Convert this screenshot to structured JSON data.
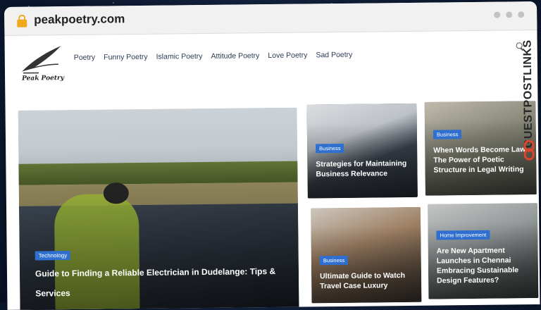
{
  "browser": {
    "url": "peakpoetry.com"
  },
  "site": {
    "logo_text": "Peak Poetry",
    "nav": [
      "Poetry",
      "Funny Poetry",
      "Islamic Poetry",
      "Attitude Poetry",
      "Love Poetry",
      "Sad Poetry"
    ]
  },
  "hero": {
    "category": "Technology",
    "title": "Guide to Finding a Reliable Electrician in Dudelange: Tips & Services"
  },
  "cards": [
    {
      "category": "Business",
      "title": "Strategies for Maintaining Business Relevance"
    },
    {
      "category": "Business",
      "title": "When Words Become Law The Power of Poetic Structure in Legal Writing"
    },
    {
      "category": "Business",
      "title": "Ultimate Guide to Watch Travel Case Luxury"
    },
    {
      "category": "Home Improvement",
      "title": "Are New Apartment Launches in Chennai Embracing Sustainable Design Features?"
    }
  ],
  "watermark": {
    "text": "GUESTPOSTLINKS"
  },
  "colors": {
    "badge": "#2f6fd0",
    "lock": "#f0a81c",
    "watermark_icon": "#e0442b"
  },
  "icons": [
    "lock-icon",
    "search-icon",
    "link-icon"
  ]
}
